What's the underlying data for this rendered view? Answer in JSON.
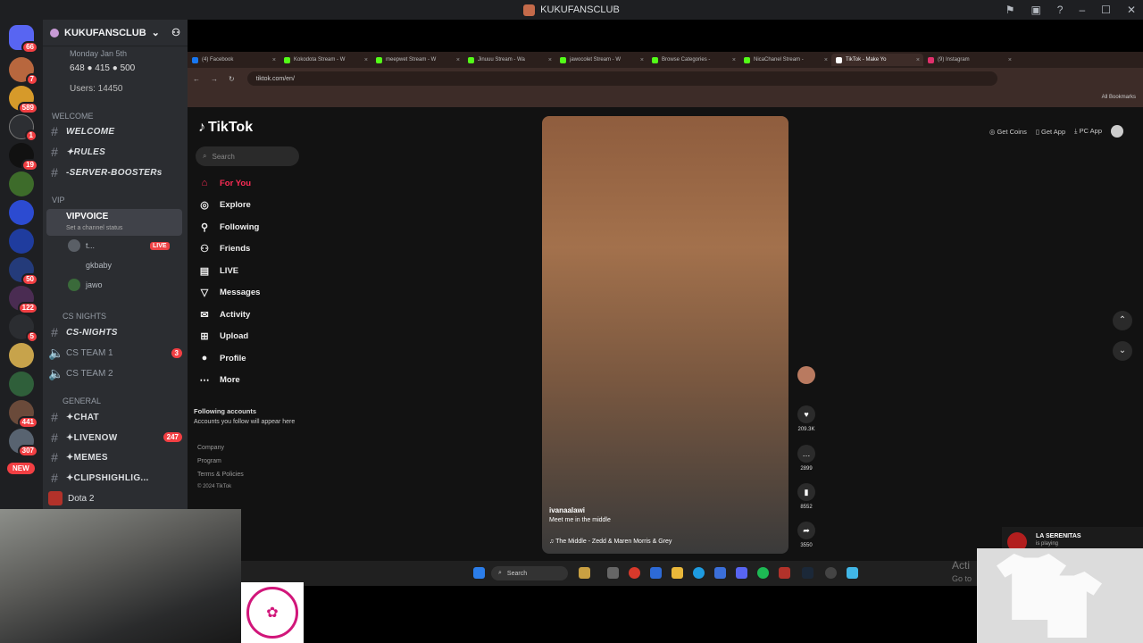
{
  "discord": {
    "window_title": "KUKUFANSCLUB",
    "server_name": "KUKUFANSCLUB",
    "info_date": "Monday Jan 5th",
    "info_stats": "648 ● 415 ● 500",
    "users": "Users: 14450",
    "categories": {
      "welcome": "WELCOME",
      "vip": "VIP",
      "cs_nights": "CS NIGHTS",
      "general": "GENERAL"
    },
    "channels": {
      "welcome": "WELCOME",
      "rules": "✦RULES",
      "boosters": "-SERVER-BOOSTERs",
      "vipvoice": "VIPVOICE",
      "channel_status": "Set a channel status",
      "cs_nights": "CS-NIGHTS",
      "cs_team_1": "CS TEAM 1",
      "cs_team_2": "CS TEAM 2",
      "chat": "✦CHAT",
      "livenow": "✦LIVENOW",
      "memes": "✦MEMES",
      "clips": "✦CLIPSHIGHLIG..."
    },
    "badges": {
      "cs_team_1": "3",
      "livenow": "247"
    },
    "voice_users": [
      {
        "name": "t...",
        "live": "LIVE"
      },
      {
        "name": "gkbaby"
      },
      {
        "name": "jawo"
      }
    ],
    "server_badges": [
      "66",
      "7",
      "589",
      "1",
      "19",
      "50",
      "122",
      "5",
      "441",
      "307"
    ],
    "new_pill": "NEW",
    "game_activity": "Dota 2"
  },
  "browser": {
    "tabs": [
      {
        "label": "(4) Facebook",
        "color": "#1877f2"
      },
      {
        "label": "Kokodota Stream - W",
        "color": "#53fc18"
      },
      {
        "label": "meepwet Stream - W",
        "color": "#53fc18"
      },
      {
        "label": "Jinuuu Stream - Wa",
        "color": "#53fc18"
      },
      {
        "label": "jawocolet Stream - W",
        "color": "#53fc18"
      },
      {
        "label": "Browse Categories - ",
        "color": "#53fc18"
      },
      {
        "label": "NicaChanel Stream -",
        "color": "#53fc18"
      },
      {
        "label": "TikTok - Make Yo",
        "color": "#ffffff"
      },
      {
        "label": "(9) Instagram",
        "color": "#e1306c"
      }
    ],
    "url": "tiktok.com/en/",
    "all_bookmarks": "All Bookmarks"
  },
  "tiktok": {
    "logo": "TikTok",
    "search_placeholder": "Search",
    "nav": [
      {
        "label": "For You",
        "icon": "home-icon"
      },
      {
        "label": "Explore",
        "icon": "compass-icon"
      },
      {
        "label": "Following",
        "icon": "user-plus-icon"
      },
      {
        "label": "Friends",
        "icon": "users-icon"
      },
      {
        "label": "LIVE",
        "icon": "live-icon"
      },
      {
        "label": "Messages",
        "icon": "send-icon"
      },
      {
        "label": "Activity",
        "icon": "inbox-icon"
      },
      {
        "label": "Upload",
        "icon": "plus-square-icon"
      },
      {
        "label": "Profile",
        "icon": "avatar-icon"
      },
      {
        "label": "More",
        "icon": "more-icon"
      }
    ],
    "following_accounts_title": "Following accounts",
    "following_accounts_sub": "Accounts you follow will appear here",
    "footer": [
      "Company",
      "Program",
      "Terms & Policies",
      "© 2024 TikTok"
    ],
    "top_right": {
      "coins": "Get Coins",
      "app": "Get App",
      "pc_app": "PC App"
    },
    "video": {
      "author": "ivanaalawi",
      "caption": "Meet me in the middle",
      "song": "The Middle - Zedd & Maren Morris & Grey",
      "likes": "209.3K",
      "comments": "2899",
      "saves": "8552",
      "shares": "3550"
    }
  },
  "windows": {
    "search": "Search",
    "activate_title": "Acti",
    "activate_sub": "Go to"
  },
  "overlay": {
    "np_title": "LA SERENITAS",
    "np_sub": "is playing"
  }
}
